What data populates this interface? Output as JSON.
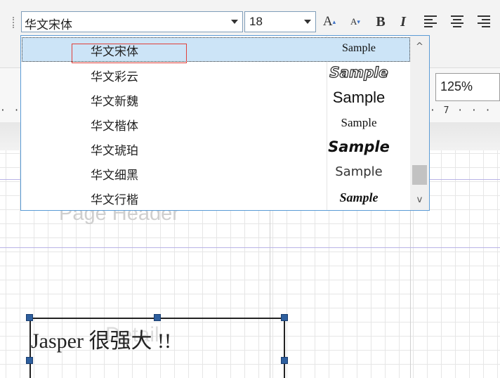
{
  "toolbar": {
    "font_value": "华文宋体",
    "size_value": "18",
    "grow_label": "A",
    "shrink_label": "A",
    "bold_label": "B",
    "italic_label": "I",
    "align_icons": [
      "align-left-icon",
      "align-center-icon",
      "align-right-icon"
    ]
  },
  "zoom": {
    "value": "125%"
  },
  "ruler": {
    "left_text": "· ·",
    "right_text": "· 7 · · · ·"
  },
  "font_dropdown": {
    "items": [
      {
        "name": "华文宋体",
        "sample": "Sample",
        "selected": true
      },
      {
        "name": "华文彩云",
        "sample": "Sample"
      },
      {
        "name": "华文新魏",
        "sample": "Sample"
      },
      {
        "name": "华文楷体",
        "sample": "Sample"
      },
      {
        "name": "华文琥珀",
        "sample": "Sample"
      },
      {
        "name": "华文细黑",
        "sample": "Sample"
      },
      {
        "name": "华文行楷",
        "sample": "Sample"
      }
    ],
    "scroll_up": "^",
    "scroll_down": "v"
  },
  "canvas": {
    "page_header_label": "Page Header",
    "detail_label": "Detail",
    "textfield_text": "Jasper 很强大 !!"
  },
  "colors": {
    "selection": "#cce4f7",
    "dropdown_border": "#5b9bd5",
    "highlight_rect": "#e0403a",
    "handle": "#2e5f9e",
    "band_line": "#b9b3e6"
  }
}
